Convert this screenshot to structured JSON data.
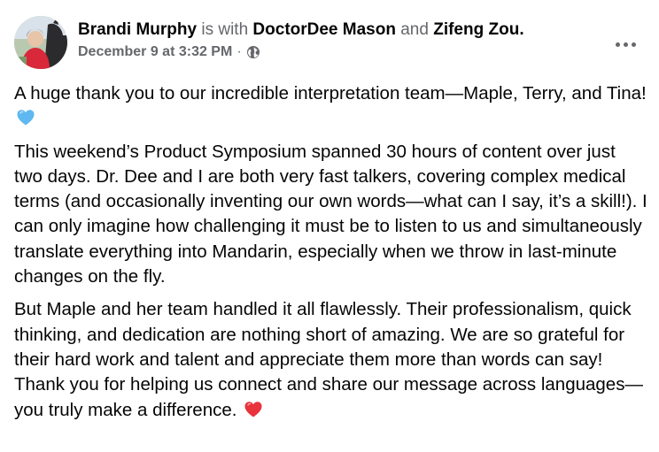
{
  "post": {
    "author": "Brandi Murphy",
    "with_text": "is with",
    "tagged_1": "DoctorDee Mason",
    "and_text": "and",
    "tagged_2": "Zifeng Zou",
    "period": ".",
    "timestamp": "December 9 at 3:32 PM",
    "separator": "·",
    "audience_icon": "globe-icon",
    "more_icon": "more-horizontal-icon",
    "paragraphs": [
      "A huge thank you to our incredible interpretation team—Maple, Terry, and Tina!",
      "This weekend’s Product Symposium spanned 30 hours of content over just two days. Dr. Dee and I are both very fast talkers, covering complex medical terms (and occasionally inventing our own words—what can I say, it’s a skill!). I can only imagine how challenging it must be to listen to us and simultaneously translate everything into Mandarin, especially when we throw in last-minute changes on the fly.",
      "But Maple and her team handled it all flawlessly. Their professionalism, quick thinking, and dedication are nothing short of amazing. We are so grateful for their hard work and talent and appreciate them more than words can say! Thank you for helping us connect and share our message across languages—you truly make a difference."
    ],
    "emoji_1": "blue-heart-emoji",
    "emoji_3": "red-heart-emoji"
  },
  "colors": {
    "text": "#050505",
    "muted": "#65676b",
    "blue_heart": "#5fb8f0",
    "red_heart": "#e8323c"
  }
}
